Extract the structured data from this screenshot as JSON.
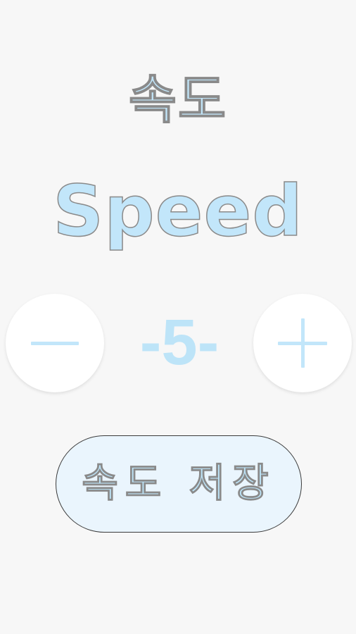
{
  "title": {
    "korean": "속도",
    "english": "Speed"
  },
  "controls": {
    "minus_icon": "minus-icon",
    "plus_icon": "plus-icon",
    "speed_display": "-5-"
  },
  "save_button": {
    "label": "속도 저장"
  },
  "colors": {
    "accent": "#c2e6fa",
    "background": "#f7f7f7",
    "button_bg": "#eaf5fd",
    "button_border": "#3a3a3a"
  }
}
